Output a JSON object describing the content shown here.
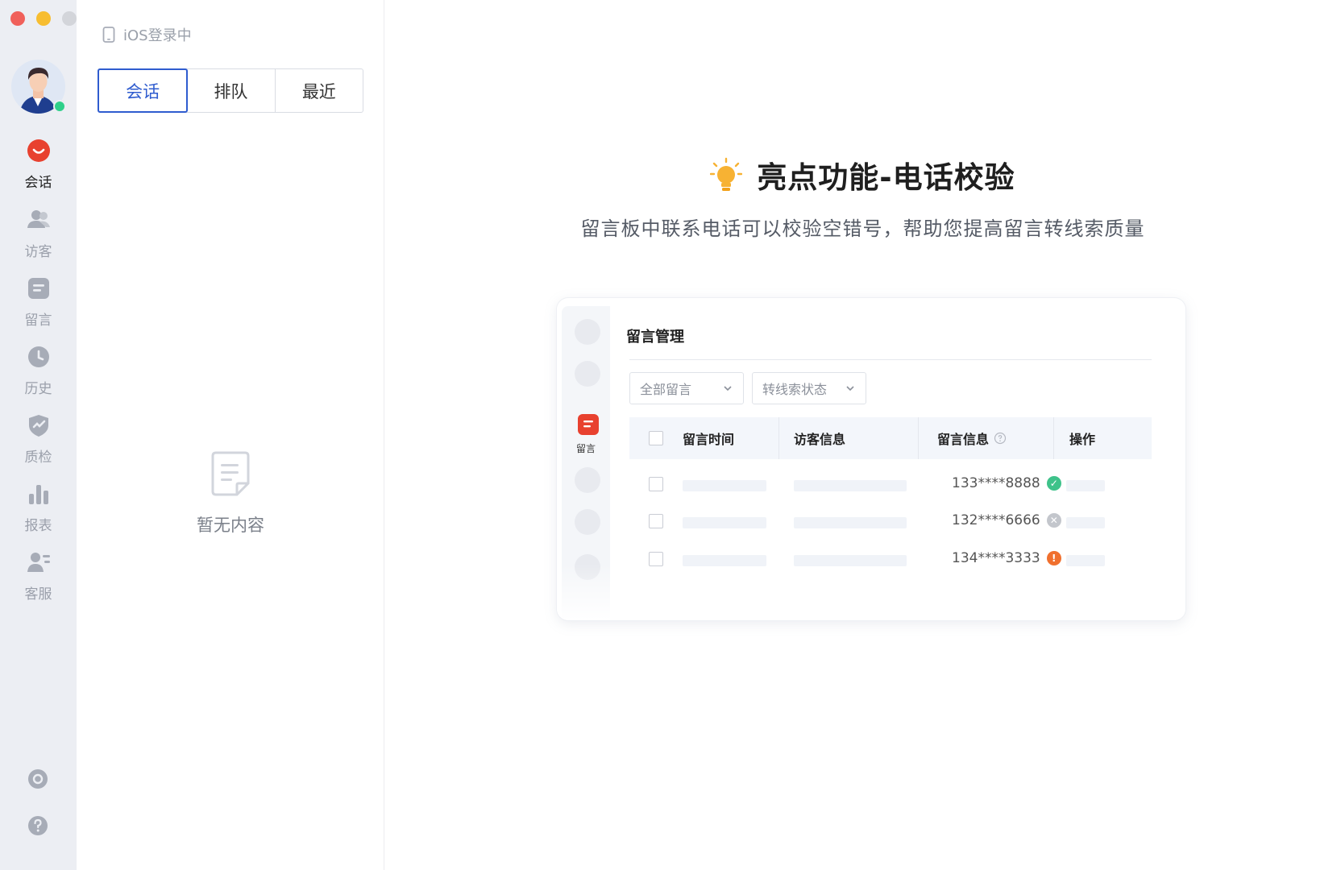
{
  "rail": {
    "nav": [
      {
        "label": "会话",
        "icon": "chat-bubble-icon",
        "active": true
      },
      {
        "label": "访客",
        "icon": "visitors-icon",
        "active": false
      },
      {
        "label": "留言",
        "icon": "message-board-icon",
        "active": false
      },
      {
        "label": "历史",
        "icon": "history-clock-icon",
        "active": false
      },
      {
        "label": "质检",
        "icon": "quality-shield-icon",
        "active": false
      },
      {
        "label": "报表",
        "icon": "report-chart-icon",
        "active": false
      },
      {
        "label": "客服",
        "icon": "agent-icon",
        "active": false
      }
    ],
    "bottom": [
      "settings-icon",
      "help-icon"
    ]
  },
  "column": {
    "login_status": "iOS登录中",
    "tabs": [
      {
        "label": "会话",
        "active": true
      },
      {
        "label": "排队",
        "active": false
      },
      {
        "label": "最近",
        "active": false
      }
    ],
    "empty_text": "暂无内容"
  },
  "main": {
    "title": "亮点功能-电话校验",
    "subtitle": "留言板中联系电话可以校验空错号，帮助您提高留言转线索质量",
    "preview": {
      "rail_label": "留言",
      "title": "留言管理",
      "filter_all": "全部留言",
      "filter_status": "转线索状态",
      "columns": [
        "留言时间",
        "访客信息",
        "留言信息",
        "操作"
      ],
      "rows": [
        {
          "phone": "133****8888",
          "status": "valid",
          "status_color": "#3ec28a"
        },
        {
          "phone": "132****6666",
          "status": "invalid",
          "status_color": "#c3c6cc"
        },
        {
          "phone": "134****3333",
          "status": "warning",
          "status_color": "#f0702e"
        }
      ]
    }
  },
  "colors": {
    "accent": "#2f5ccf",
    "brand_red": "#e8412f",
    "online": "#2fd08a",
    "idea": "#f7b233"
  }
}
